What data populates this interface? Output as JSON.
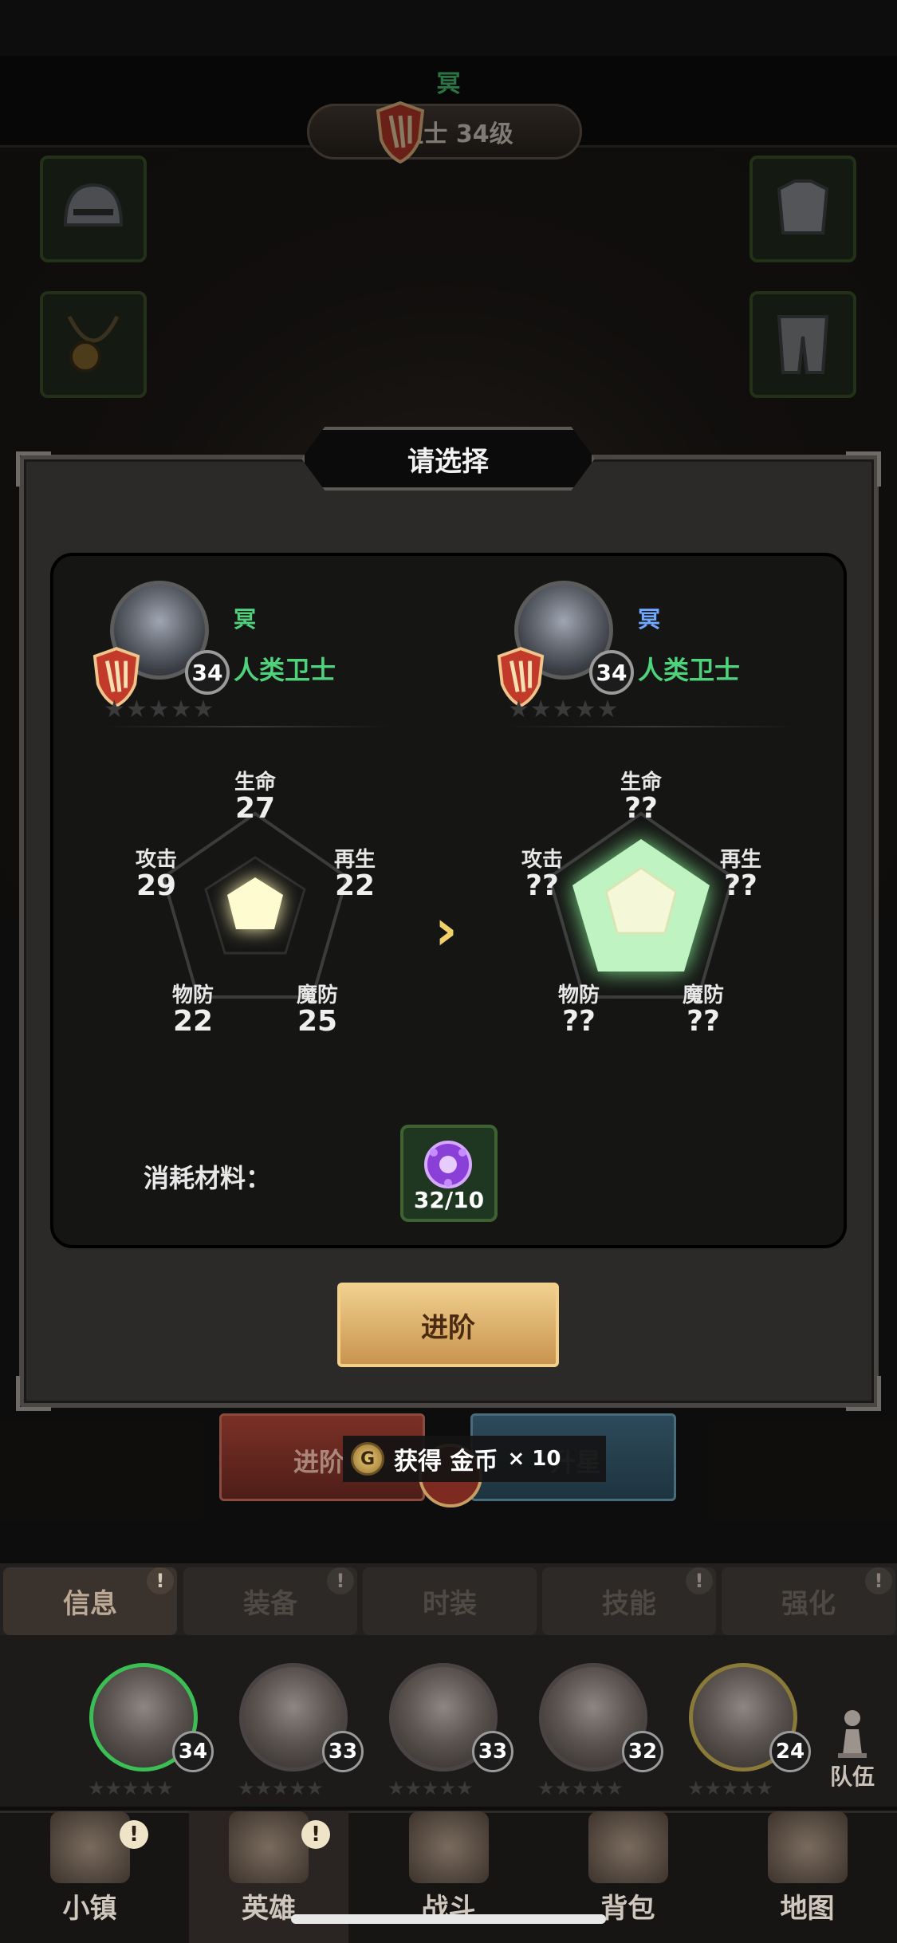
{
  "header": {
    "hero_name": "冥",
    "rank_label": "卫士 34级"
  },
  "dialog": {
    "title": "请选择",
    "current": {
      "name": "冥",
      "level": "34",
      "role": "人类卫士",
      "stars": "★★★★★",
      "stats": {
        "hp_label": "生命",
        "hp": "27",
        "atk_label": "攻击",
        "atk": "29",
        "regen_label": "再生",
        "regen": "22",
        "pdef_label": "物防",
        "pdef": "22",
        "mdef_label": "魔防",
        "mdef": "25"
      }
    },
    "next": {
      "name": "冥",
      "level": "34",
      "role": "人类卫士",
      "stars": "★★★★★",
      "stats": {
        "hp_label": "生命",
        "hp": "??",
        "atk_label": "攻击",
        "atk": "??",
        "regen_label": "再生",
        "regen": "??",
        "pdef_label": "物防",
        "pdef": "??",
        "mdef_label": "魔防",
        "mdef": "??"
      }
    },
    "arrow": "›",
    "material_label": "消耗材料：",
    "material_count": "32/10",
    "advance_button": "进阶"
  },
  "toggles": {
    "left": "进阶",
    "right": "升星"
  },
  "toast": {
    "coin_glyph": "G",
    "text": "获得 金币",
    "amount": "× 10"
  },
  "tabs": [
    {
      "label": "信息",
      "active": true
    },
    {
      "label": "装备"
    },
    {
      "label": "时装"
    },
    {
      "label": "技能"
    },
    {
      "label": "强化"
    }
  ],
  "roster": [
    {
      "level": "34"
    },
    {
      "level": "33"
    },
    {
      "level": "33"
    },
    {
      "level": "32"
    },
    {
      "level": "24"
    }
  ],
  "roster_stars": "★★★★★",
  "team_label": "队伍",
  "nav": [
    {
      "label": "小镇"
    },
    {
      "label": "英雄"
    },
    {
      "label": "战斗"
    },
    {
      "label": "背包"
    },
    {
      "label": "地图"
    }
  ],
  "exclaim": "!",
  "colors": {
    "green": "#4fd27b",
    "blue_name": "#6fa8ff",
    "gold": "#f0cf8d"
  }
}
